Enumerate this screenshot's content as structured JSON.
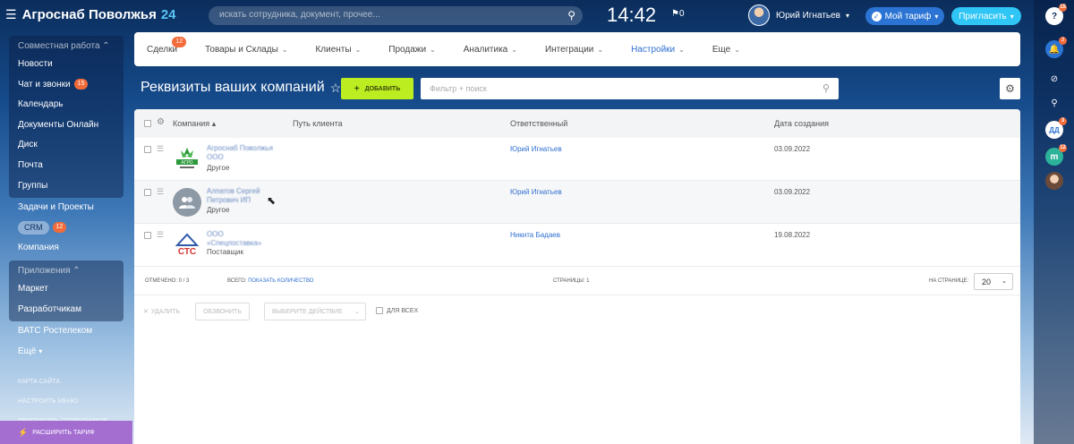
{
  "topbar": {
    "company_name": "Агроснаб Поволжья",
    "company_number": "24",
    "search_placeholder": "искать сотрудника, документ, прочее...",
    "clock": "14:42",
    "flag_count": "0",
    "user_name": "Юрий Игнатьев",
    "tariff_button": "Мой тариф",
    "invite_button": "Пригласить"
  },
  "sidebar": {
    "groups": [
      {
        "header": "Совместная работа",
        "items": [
          {
            "label": "Новости"
          },
          {
            "label": "Чат и звонки",
            "badge": "15"
          },
          {
            "label": "Календарь"
          },
          {
            "label": "Документы Онлайн"
          },
          {
            "label": "Диск"
          },
          {
            "label": "Почта"
          },
          {
            "label": "Группы"
          }
        ]
      }
    ],
    "loose_items": {
      "tasks": "Задачи и Проекты",
      "crm": "CRM",
      "crm_badge": "12",
      "company": "Компания"
    },
    "apps_group": {
      "header": "Приложения",
      "items": [
        {
          "label": "Маркет"
        },
        {
          "label": "Разработчикам"
        }
      ]
    },
    "after_items": {
      "vats": "ВАТС Ростелеком",
      "more": "Ещё"
    },
    "small_links": [
      "Карта сайта",
      "Настроить меню",
      "Пригласить сотрудников"
    ],
    "expand_tariff": "Расширить тариф"
  },
  "navbar": {
    "items": [
      {
        "label": "Сделки",
        "badge": "12",
        "dropdown": false,
        "active": false
      },
      {
        "label": "Товары и Склады",
        "dropdown": true,
        "active": false
      },
      {
        "label": "Клиенты",
        "dropdown": true,
        "active": false
      },
      {
        "label": "Продажи",
        "dropdown": true,
        "active": false
      },
      {
        "label": "Аналитика",
        "dropdown": true,
        "active": false
      },
      {
        "label": "Интеграции",
        "dropdown": true,
        "active": false
      },
      {
        "label": "Настройки",
        "dropdown": true,
        "active": true
      },
      {
        "label": "Еще",
        "dropdown": true,
        "active": false
      }
    ]
  },
  "page": {
    "title": "Реквизиты ваших компаний",
    "add_button": "Добавить",
    "filter_placeholder": "Фильтр + поиск"
  },
  "table": {
    "columns": {
      "company": "Компания",
      "path": "Путь клиента",
      "responsible": "Ответственный",
      "created": "Дата создания"
    },
    "rows": [
      {
        "name_line1": "Агроснаб Поволжья",
        "name_line2": "ООО",
        "type": "Другое",
        "responsible": "Юрий Игнатьев",
        "date": "03.09.2022",
        "logo": "agro-logo"
      },
      {
        "name_line1": "Алпатов Сергей",
        "name_line2": "Петрович ИП",
        "type": "Другое",
        "responsible": "Юрий Игнатьев",
        "date": "03.09.2022",
        "logo": "people-icon"
      },
      {
        "name_line1": "ООО",
        "name_line2": "«Спецпоставка»",
        "type": "Поставщик",
        "responsible": "Никита Бадаев",
        "date": "19.08.2022",
        "logo": "stc-logo"
      }
    ],
    "footer": {
      "marked": "Отмечено: 0 / 3",
      "total_label": "Всего:",
      "show_count": "Показать количество",
      "pages": "Страницы: 1",
      "per_page_label": "На странице:",
      "per_page_value": "20"
    },
    "actions": {
      "delete": "Удалить",
      "call": "Обзвонить",
      "choose_action": "Выберите действие",
      "for_all": "Для всех"
    }
  },
  "rail": {
    "help_badge": "15",
    "bell_badge": "3",
    "chat_badge": "3",
    "m_badge": "12"
  },
  "colors": {
    "accent_blue": "#2f6fd0",
    "add_green": "#bbed21",
    "badge_orange": "#f26b3a",
    "expand_purple": "#a46ed1"
  }
}
